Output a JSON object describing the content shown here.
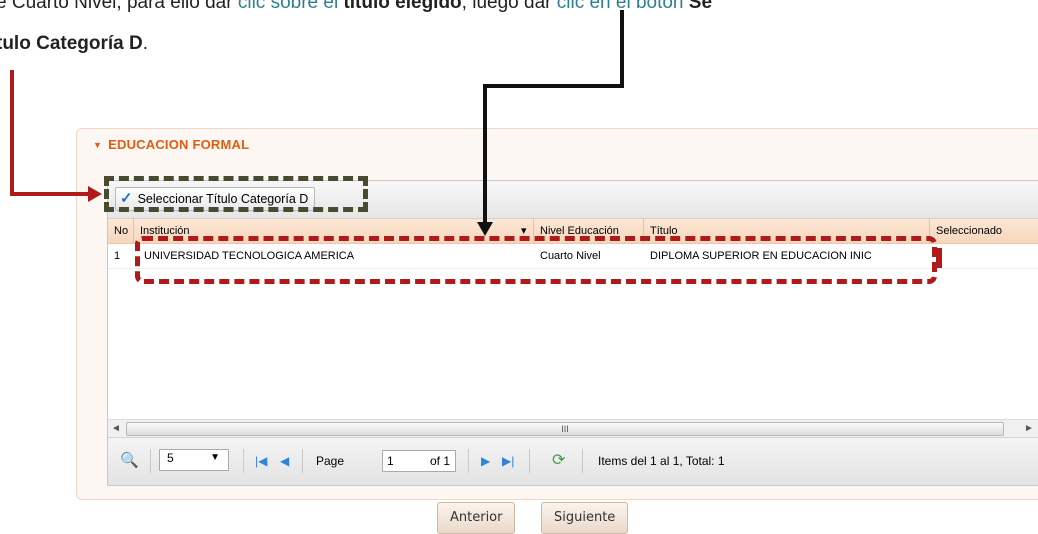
{
  "doc": {
    "line1_a": "e Cuarto Nivel, para ello dar ",
    "line1_link1": "clic sobre el",
    "line1_bold": "título elegido",
    "line1_b": ", luego dar ",
    "line1_link2": "clic en el botón",
    "line1_bold2": "Se",
    "line2_bold": "tulo Categoría D",
    "line2_end": "."
  },
  "panel": {
    "title": "EDUCACION FORMAL"
  },
  "toolbar": {
    "select_label": "Seleccionar Título Categoría D"
  },
  "grid": {
    "columns": [
      "No",
      "Institución",
      "Nivel Educación",
      "Título",
      "Seleccionado"
    ],
    "rows": [
      {
        "no": "1",
        "institucion": "UNIVERSIDAD TECNOLOGICA AMERICA",
        "nivel": "Cuarto Nivel",
        "titulo": "DIPLOMA SUPERIOR EN EDUCACION INIC",
        "seleccionado": ""
      }
    ],
    "scroll_glyph": "III"
  },
  "pager": {
    "page_size": "5",
    "page_label": "Page",
    "page_value": "1",
    "of_label": "of 1",
    "items_text": "Items del 1 al 1, Total: 1"
  },
  "buttons": {
    "prev": "Anterior",
    "next": "Siguiente"
  },
  "colors": {
    "accent": "#e35d10",
    "annotation_red": "#b01a1a",
    "annotation_dark": "#4a4a30",
    "link": "#2f7f8f"
  }
}
